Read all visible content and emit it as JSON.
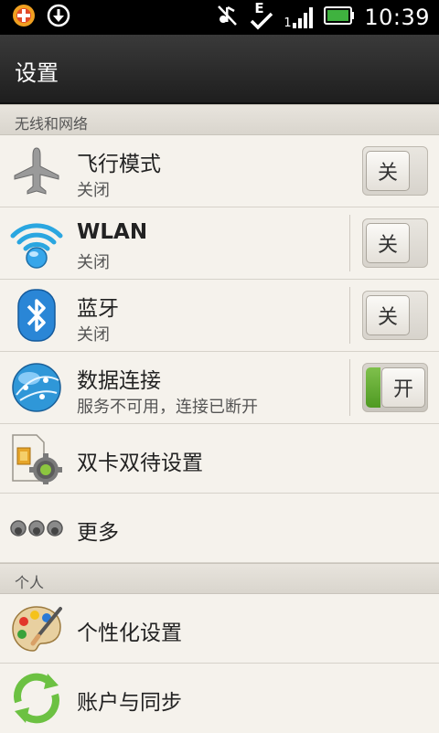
{
  "status_bar": {
    "time": "10:39",
    "network_letter": "E",
    "signal_digit": "1"
  },
  "header": {
    "title": "设置"
  },
  "sections": {
    "wireless": {
      "title": "无线和网络"
    },
    "personal": {
      "title": "个人"
    }
  },
  "rows": {
    "airplane": {
      "label": "飞行模式",
      "sub": "关闭",
      "toggle": "关"
    },
    "wlan": {
      "label": "WLAN",
      "sub": "关闭",
      "toggle": "关"
    },
    "bluetooth": {
      "label": "蓝牙",
      "sub": "关闭",
      "toggle": "关"
    },
    "data": {
      "label": "数据连接",
      "sub": "服务不可用，连接已断开",
      "toggle": "开"
    },
    "dual_sim": {
      "label": "双卡双待设置"
    },
    "more": {
      "label": "更多"
    },
    "personalize": {
      "label": "个性化设置"
    },
    "accounts": {
      "label": "账户与同步"
    }
  },
  "colors": {
    "battery_green": "#3fb23f",
    "toggle_on_green": "#5aa82b"
  },
  "icons": {
    "status_left": [
      "app-notification-icon",
      "download-icon"
    ],
    "status_right": [
      "mute-icon",
      "sync-check-icon",
      "signal-icon",
      "battery-icon"
    ],
    "rows": [
      "airplane-icon",
      "wifi-icon",
      "bluetooth-icon",
      "globe-icon",
      "sim-card-gear-icon",
      "more-dots-icon",
      "palette-icon",
      "sync-arrows-icon"
    ]
  }
}
